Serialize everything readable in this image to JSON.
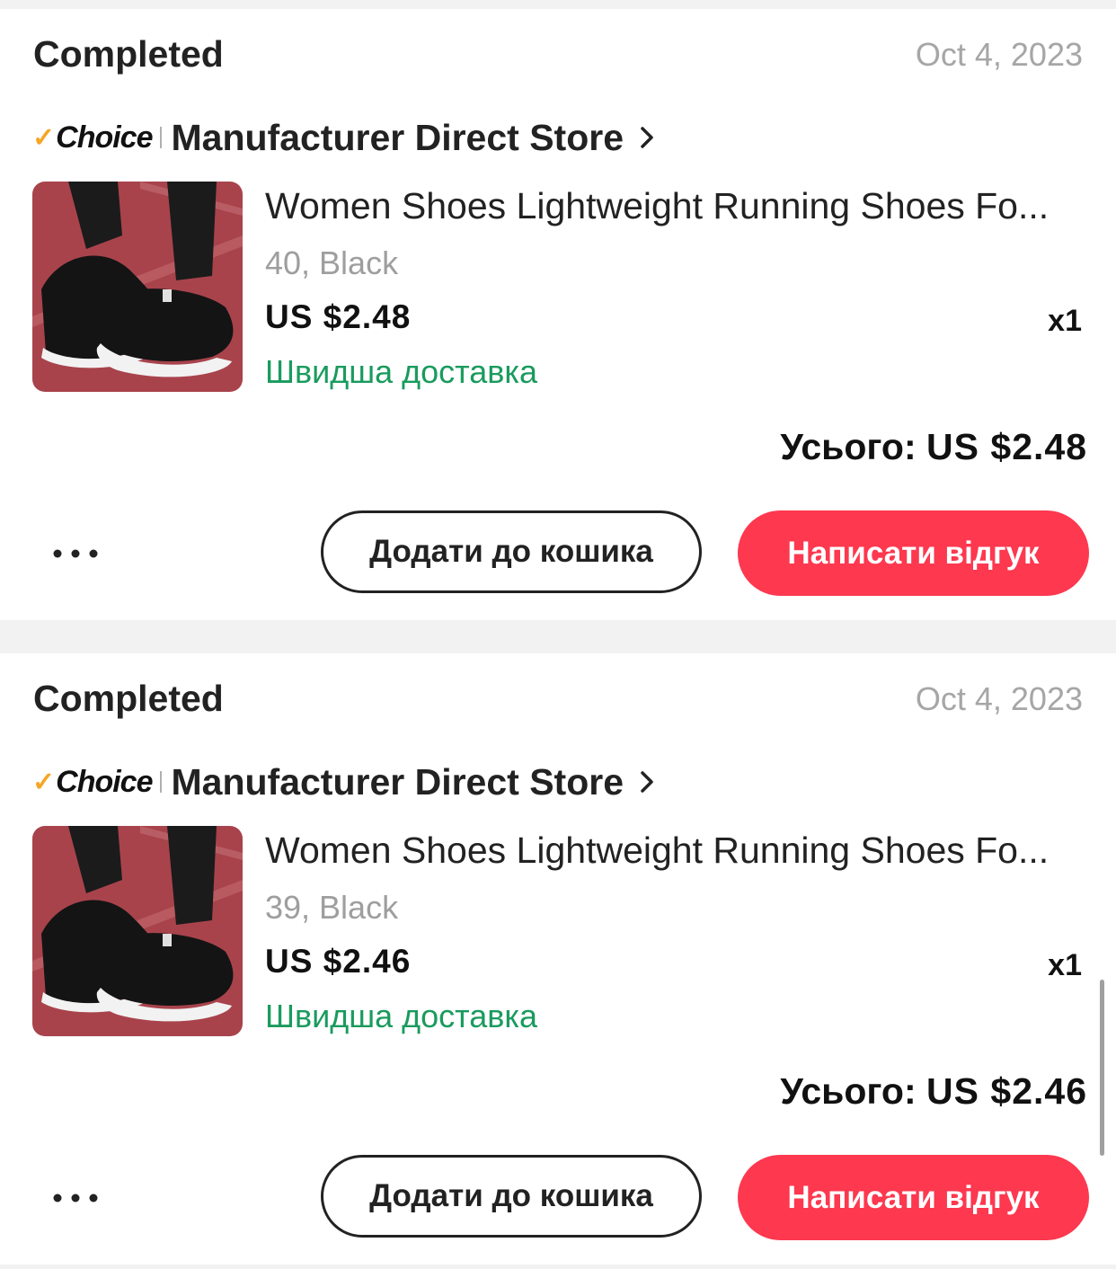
{
  "orders": [
    {
      "status": "Completed",
      "date": "Oct 4, 2023",
      "choice_badge": "Choice",
      "store_name": "Manufacturer Direct Store",
      "product": {
        "title": "Women Shoes Lightweight Running Shoes Fo...",
        "variant": "40, Black",
        "price": "US $2.48",
        "quantity": "x1",
        "delivery": "Швидша доставка"
      },
      "total_label": "Усього:",
      "total_value": "US $2.48",
      "more_icon": "more-horizontal-icon",
      "add_to_cart_label": "Додати до кошика",
      "write_review_label": "Написати відгук"
    },
    {
      "status": "Completed",
      "date": "Oct 4, 2023",
      "choice_badge": "Choice",
      "store_name": "Manufacturer Direct Store",
      "product": {
        "title": "Women Shoes Lightweight Running Shoes Fo...",
        "variant": "39, Black",
        "price": "US $2.46",
        "quantity": "x1",
        "delivery": "Швидша доставка"
      },
      "total_label": "Усього:",
      "total_value": "US $2.46",
      "more_icon": "more-horizontal-icon",
      "add_to_cart_label": "Додати до кошика",
      "write_review_label": "Написати відгук"
    }
  ],
  "colors": {
    "accent_red": "#fd384f",
    "delivery_green": "#1a9b5e",
    "choice_check": "#f5a623",
    "muted_text": "#9e9e9e",
    "page_bg": "#f2f2f2"
  }
}
